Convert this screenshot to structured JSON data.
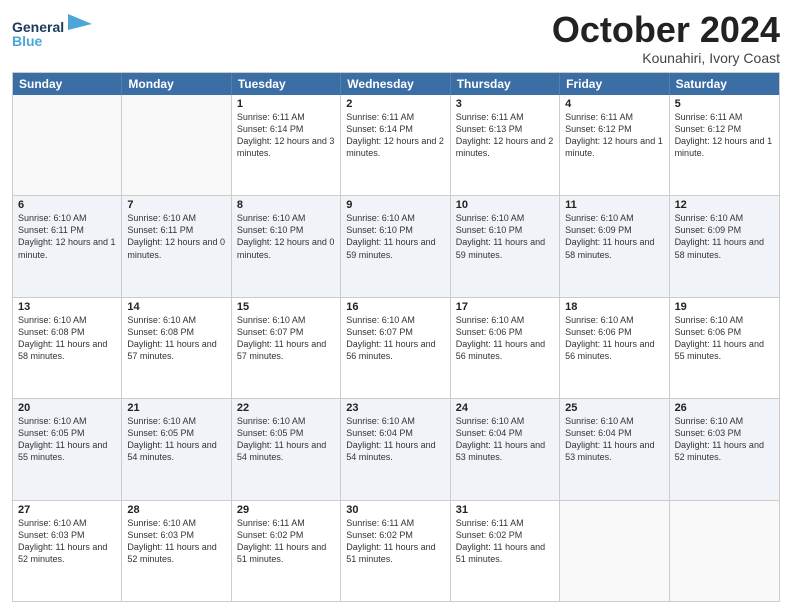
{
  "header": {
    "logo_general": "General",
    "logo_blue": "Blue",
    "month_title": "October 2024",
    "location": "Kounahiri, Ivory Coast"
  },
  "days_of_week": [
    "Sunday",
    "Monday",
    "Tuesday",
    "Wednesday",
    "Thursday",
    "Friday",
    "Saturday"
  ],
  "rows": [
    [
      {
        "day": "",
        "text": "",
        "empty": true
      },
      {
        "day": "",
        "text": "",
        "empty": true
      },
      {
        "day": "1",
        "text": "Sunrise: 6:11 AM\nSunset: 6:14 PM\nDaylight: 12 hours and 3 minutes."
      },
      {
        "day": "2",
        "text": "Sunrise: 6:11 AM\nSunset: 6:14 PM\nDaylight: 12 hours and 2 minutes."
      },
      {
        "day": "3",
        "text": "Sunrise: 6:11 AM\nSunset: 6:13 PM\nDaylight: 12 hours and 2 minutes."
      },
      {
        "day": "4",
        "text": "Sunrise: 6:11 AM\nSunset: 6:12 PM\nDaylight: 12 hours and 1 minute."
      },
      {
        "day": "5",
        "text": "Sunrise: 6:11 AM\nSunset: 6:12 PM\nDaylight: 12 hours and 1 minute."
      }
    ],
    [
      {
        "day": "6",
        "text": "Sunrise: 6:10 AM\nSunset: 6:11 PM\nDaylight: 12 hours and 1 minute.",
        "shaded": true
      },
      {
        "day": "7",
        "text": "Sunrise: 6:10 AM\nSunset: 6:11 PM\nDaylight: 12 hours and 0 minutes.",
        "shaded": true
      },
      {
        "day": "8",
        "text": "Sunrise: 6:10 AM\nSunset: 6:10 PM\nDaylight: 12 hours and 0 minutes.",
        "shaded": true
      },
      {
        "day": "9",
        "text": "Sunrise: 6:10 AM\nSunset: 6:10 PM\nDaylight: 11 hours and 59 minutes.",
        "shaded": true
      },
      {
        "day": "10",
        "text": "Sunrise: 6:10 AM\nSunset: 6:10 PM\nDaylight: 11 hours and 59 minutes.",
        "shaded": true
      },
      {
        "day": "11",
        "text": "Sunrise: 6:10 AM\nSunset: 6:09 PM\nDaylight: 11 hours and 58 minutes.",
        "shaded": true
      },
      {
        "day": "12",
        "text": "Sunrise: 6:10 AM\nSunset: 6:09 PM\nDaylight: 11 hours and 58 minutes.",
        "shaded": true
      }
    ],
    [
      {
        "day": "13",
        "text": "Sunrise: 6:10 AM\nSunset: 6:08 PM\nDaylight: 11 hours and 58 minutes."
      },
      {
        "day": "14",
        "text": "Sunrise: 6:10 AM\nSunset: 6:08 PM\nDaylight: 11 hours and 57 minutes."
      },
      {
        "day": "15",
        "text": "Sunrise: 6:10 AM\nSunset: 6:07 PM\nDaylight: 11 hours and 57 minutes."
      },
      {
        "day": "16",
        "text": "Sunrise: 6:10 AM\nSunset: 6:07 PM\nDaylight: 11 hours and 56 minutes."
      },
      {
        "day": "17",
        "text": "Sunrise: 6:10 AM\nSunset: 6:06 PM\nDaylight: 11 hours and 56 minutes."
      },
      {
        "day": "18",
        "text": "Sunrise: 6:10 AM\nSunset: 6:06 PM\nDaylight: 11 hours and 56 minutes."
      },
      {
        "day": "19",
        "text": "Sunrise: 6:10 AM\nSunset: 6:06 PM\nDaylight: 11 hours and 55 minutes."
      }
    ],
    [
      {
        "day": "20",
        "text": "Sunrise: 6:10 AM\nSunset: 6:05 PM\nDaylight: 11 hours and 55 minutes.",
        "shaded": true
      },
      {
        "day": "21",
        "text": "Sunrise: 6:10 AM\nSunset: 6:05 PM\nDaylight: 11 hours and 54 minutes.",
        "shaded": true
      },
      {
        "day": "22",
        "text": "Sunrise: 6:10 AM\nSunset: 6:05 PM\nDaylight: 11 hours and 54 minutes.",
        "shaded": true
      },
      {
        "day": "23",
        "text": "Sunrise: 6:10 AM\nSunset: 6:04 PM\nDaylight: 11 hours and 54 minutes.",
        "shaded": true
      },
      {
        "day": "24",
        "text": "Sunrise: 6:10 AM\nSunset: 6:04 PM\nDaylight: 11 hours and 53 minutes.",
        "shaded": true
      },
      {
        "day": "25",
        "text": "Sunrise: 6:10 AM\nSunset: 6:04 PM\nDaylight: 11 hours and 53 minutes.",
        "shaded": true
      },
      {
        "day": "26",
        "text": "Sunrise: 6:10 AM\nSunset: 6:03 PM\nDaylight: 11 hours and 52 minutes.",
        "shaded": true
      }
    ],
    [
      {
        "day": "27",
        "text": "Sunrise: 6:10 AM\nSunset: 6:03 PM\nDaylight: 11 hours and 52 minutes."
      },
      {
        "day": "28",
        "text": "Sunrise: 6:10 AM\nSunset: 6:03 PM\nDaylight: 11 hours and 52 minutes."
      },
      {
        "day": "29",
        "text": "Sunrise: 6:11 AM\nSunset: 6:02 PM\nDaylight: 11 hours and 51 minutes."
      },
      {
        "day": "30",
        "text": "Sunrise: 6:11 AM\nSunset: 6:02 PM\nDaylight: 11 hours and 51 minutes."
      },
      {
        "day": "31",
        "text": "Sunrise: 6:11 AM\nSunset: 6:02 PM\nDaylight: 11 hours and 51 minutes."
      },
      {
        "day": "",
        "text": "",
        "empty": true
      },
      {
        "day": "",
        "text": "",
        "empty": true
      }
    ]
  ]
}
